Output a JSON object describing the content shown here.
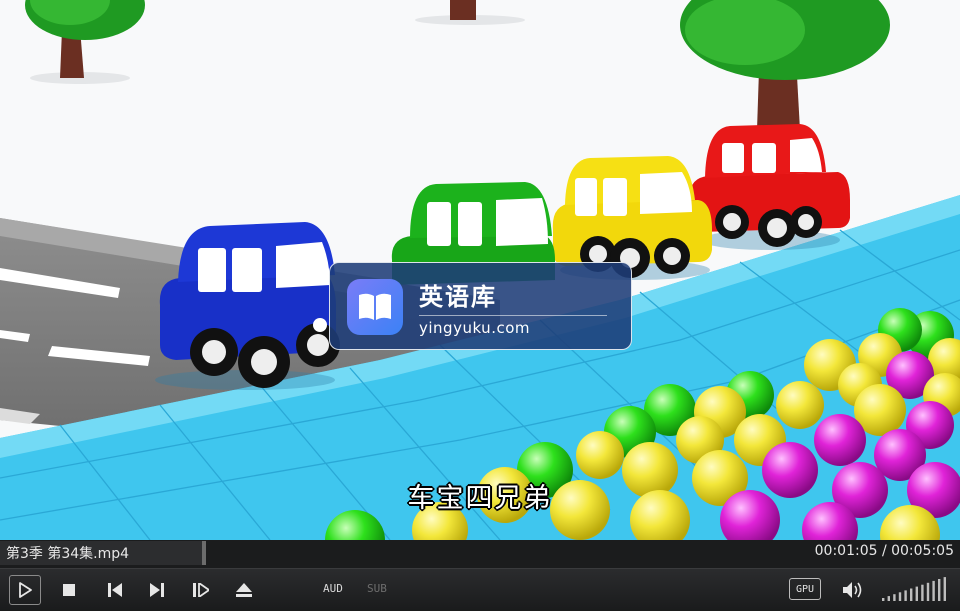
{
  "video": {
    "watermark": {
      "name": "英语库",
      "url": "yingyuku.com",
      "logo_icon": "open-book-icon"
    },
    "subtitle": "车宝四兄弟"
  },
  "info_bar": {
    "filename": "第3季 第34集.mp4",
    "time_display": "00:01:05 / 00:05:05",
    "progress_fraction": 0.213
  },
  "controls": {
    "play_icon": "play-icon",
    "stop_icon": "stop-icon",
    "previous_icon": "skip-previous-icon",
    "next_icon": "skip-next-icon",
    "frame_step_icon": "frame-step-icon",
    "eject_icon": "eject-icon",
    "audio_label": "AUD",
    "subtitle_label": "SUB",
    "gpu_label": "GPU",
    "volume_icon": "speaker-icon",
    "volume_level": 1.0
  },
  "colors": {
    "accent": "#ffffff",
    "disabled": "#6d6d6d",
    "bar_background": "#1b1c1d"
  }
}
